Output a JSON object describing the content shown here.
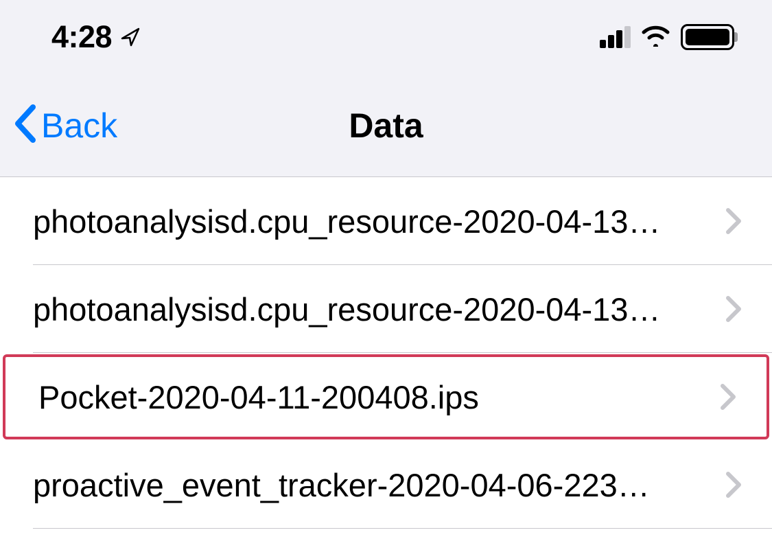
{
  "statusBar": {
    "time": "4:28"
  },
  "nav": {
    "backLabel": "Back",
    "title": "Data"
  },
  "list": {
    "items": [
      {
        "label": "photoanalysisd.cpu_resource-2020-04-13…",
        "highlighted": false
      },
      {
        "label": "photoanalysisd.cpu_resource-2020-04-13…",
        "highlighted": false
      },
      {
        "label": "Pocket-2020-04-11-200408.ips",
        "highlighted": true
      },
      {
        "label": "proactive_event_tracker-2020-04-06-223…",
        "highlighted": false
      }
    ]
  }
}
